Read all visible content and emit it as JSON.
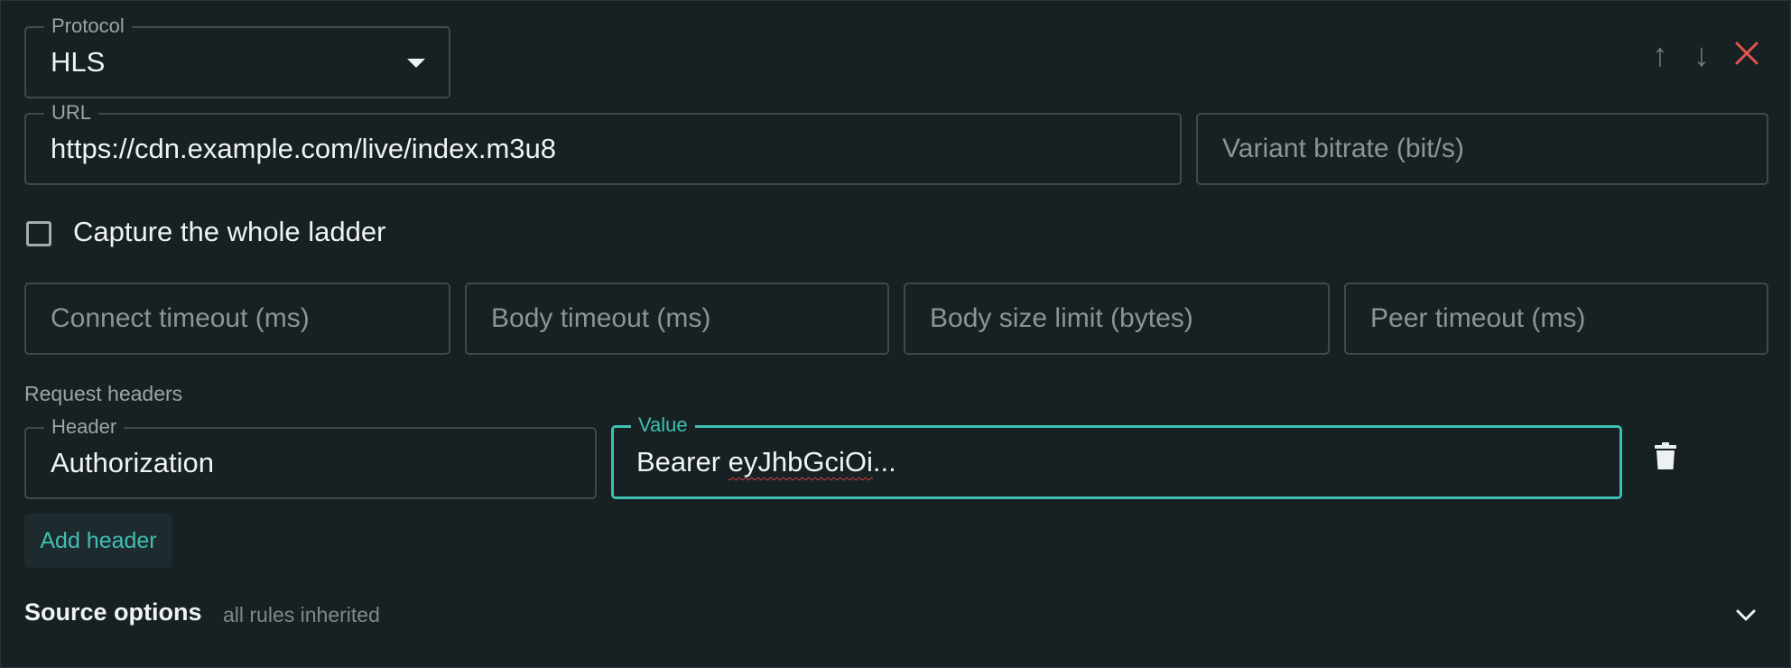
{
  "protocol": {
    "label": "Protocol",
    "value": "HLS"
  },
  "url": {
    "label": "URL",
    "value": "https://cdn.example.com/live/index.m3u8"
  },
  "variant_bitrate": {
    "placeholder": "Variant bitrate (bit/s)"
  },
  "capture_ladder": {
    "label": "Capture the whole ladder",
    "checked": false
  },
  "timeouts": {
    "connect": "Connect timeout (ms)",
    "body": "Body timeout (ms)",
    "body_size": "Body size limit (bytes)",
    "peer": "Peer timeout (ms)"
  },
  "request_headers": {
    "title": "Request headers",
    "header_label": "Header",
    "header_value": "Authorization",
    "value_label": "Value",
    "value_prefix": "Bearer ",
    "value_token": "eyJhbGciOi",
    "value_suffix": "...",
    "add_label": "Add header"
  },
  "source_options": {
    "title": "Source options",
    "subtitle": "all rules inherited"
  },
  "icons": {
    "move_up": "↑",
    "move_down": "↓",
    "close": "✕"
  },
  "colors": {
    "accent": "#3fbfb2",
    "danger": "#e0554e",
    "background": "#172023"
  }
}
